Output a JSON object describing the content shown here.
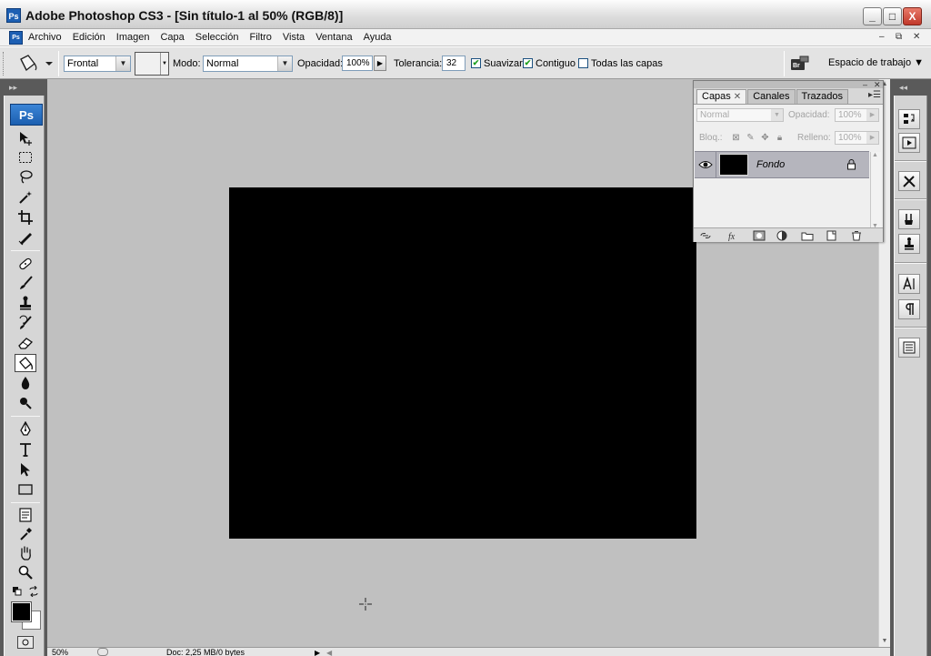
{
  "window": {
    "title": "Adobe Photoshop CS3 - [Sin título-1 al 50% (RGB/8)]",
    "app_badge": "Ps",
    "minimize": "_",
    "maximize": "□",
    "close": "X"
  },
  "menu": {
    "items": [
      "Archivo",
      "Edición",
      "Imagen",
      "Capa",
      "Selección",
      "Filtro",
      "Vista",
      "Ventana",
      "Ayuda"
    ],
    "doc_controls": [
      "–",
      "⧉",
      "✕"
    ]
  },
  "options": {
    "fill_source": "Frontal",
    "mode_label": "Modo:",
    "mode_value": "Normal",
    "opacity_label": "Opacidad:",
    "opacity_value": "100%",
    "tolerance_label": "Tolerancia:",
    "tolerance_value": "32",
    "antialias_label": "Suavizar",
    "antialias_checked": true,
    "contiguous_label": "Contiguo",
    "contiguous_checked": true,
    "all_layers_label": "Todas las capas",
    "all_layers_checked": false,
    "workspace_label": "Espacio de trabajo ▼"
  },
  "toolbox": {
    "logo": "Ps",
    "collapse": "▸▸",
    "tools": [
      "move",
      "marquee",
      "lasso",
      "magic-wand",
      "crop",
      "slice",
      "healing-brush",
      "brush",
      "clone-stamp",
      "history-brush",
      "eraser",
      "paint-bucket",
      "blur",
      "dodge",
      "pen",
      "type",
      "path-selection",
      "rectangle",
      "notes",
      "eyedropper",
      "hand",
      "zoom"
    ],
    "active_tool": "paint-bucket",
    "foreground_color": "#000000",
    "background_color": "#ffffff"
  },
  "document": {
    "fill_color": "#000000",
    "canvas_bg": "#c0c0c0"
  },
  "status": {
    "zoom": "50%",
    "doc_info": "Doc: 2,25 MB/0 bytes"
  },
  "layers_panel": {
    "tabs": [
      "Capas",
      "Canales",
      "Trazados"
    ],
    "active_tab": "Capas",
    "blend_mode": "Normal",
    "opacity_label": "Opacidad:",
    "opacity_value": "100%",
    "lock_label": "Bloq.:",
    "fill_label": "Relleno:",
    "fill_value": "100%",
    "layers": [
      {
        "name": "Fondo",
        "visible": true,
        "locked": true
      }
    ]
  },
  "right_dock": {
    "collapse": "◂◂",
    "buttons": [
      "history",
      "actions",
      "tool-presets",
      "brushes",
      "clone-source",
      "character",
      "paragraph",
      "layer-comps"
    ]
  }
}
